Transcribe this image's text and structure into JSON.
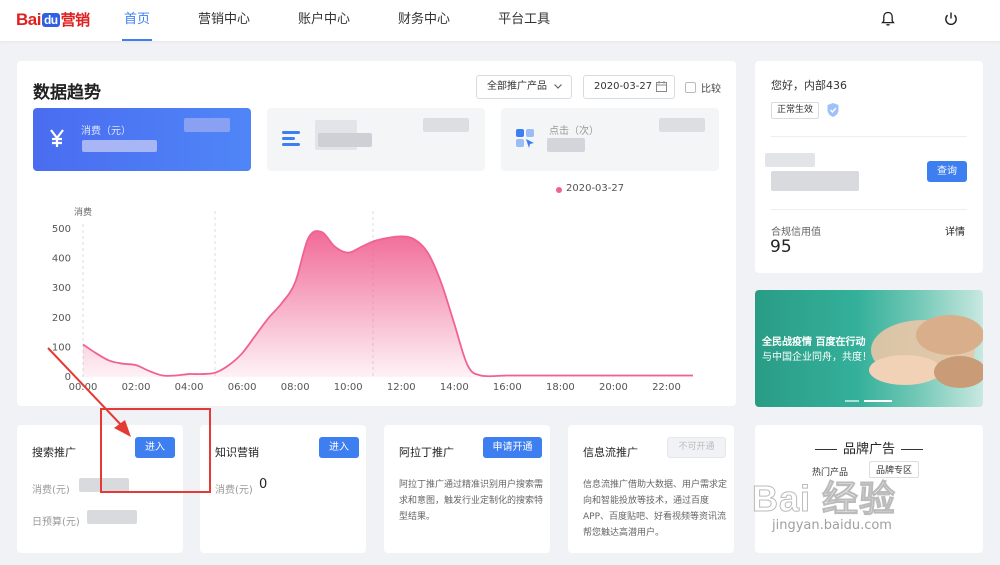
{
  "header": {
    "logo_bai": "Bai",
    "logo_du": "du",
    "logo_suffix": "营销",
    "nav": [
      "首页",
      "营销中心",
      "账户中心",
      "财务中心",
      "平台工具"
    ],
    "icons": [
      "bell-icon",
      "power-icon"
    ]
  },
  "trend": {
    "title": "数据趋势",
    "product_select": "全部推广产品",
    "date": "2020-03-27",
    "compare_label": "比较",
    "stats": [
      {
        "label": "消费（元）",
        "icon": "yuan-icon"
      },
      {
        "label": "",
        "icon": "list-icon"
      },
      {
        "label": "点击（次）",
        "icon": "grid-click-icon"
      }
    ]
  },
  "chart_data": {
    "type": "area",
    "legend": [
      "2020-03-27"
    ],
    "ylabel": "消费",
    "ylim": [
      0,
      500
    ],
    "yticks": [
      "0",
      "100",
      "200",
      "300",
      "400",
      "500"
    ],
    "xticks": [
      "00:00",
      "02:00",
      "04:00",
      "06:00",
      "08:00",
      "10:00",
      "12:00",
      "14:00",
      "16:00",
      "18:00",
      "20:00",
      "22:00"
    ],
    "x": [
      0,
      0.5,
      1,
      1.5,
      2,
      2.5,
      3,
      3.5,
      4,
      4.5,
      5,
      5.5,
      6,
      6.5,
      7,
      7.5,
      8,
      8.5,
      9,
      9.5,
      10,
      10.5,
      11,
      11.5,
      12,
      12.5,
      13,
      13.5,
      14,
      14.5,
      15,
      16,
      17,
      18,
      19,
      20,
      21,
      22,
      23
    ],
    "values": [
      110,
      80,
      55,
      45,
      40,
      20,
      5,
      5,
      10,
      10,
      15,
      40,
      80,
      140,
      200,
      250,
      320,
      470,
      490,
      440,
      420,
      440,
      460,
      470,
      475,
      465,
      420,
      320,
      180,
      40,
      5,
      5,
      5,
      5,
      5,
      5,
      5,
      5,
      5
    ],
    "color": "#f06292",
    "grid": false
  },
  "account": {
    "greeting": "您好，内部436",
    "status_badge": "正常生效",
    "query_button": "查询",
    "credit_label": "合规信用值",
    "credit_value": "95",
    "detail_link": "详情"
  },
  "banner": {
    "line1": "全民战疫情 百度在行动",
    "line2": "与中国企业同舟，共度！"
  },
  "products": [
    {
      "title": "搜索推广",
      "button": "进入",
      "line1": "消费(元)",
      "line2": "日预算(元)"
    },
    {
      "title": "知识营销",
      "button": "进入",
      "line1": "消费(元)",
      "line1_value": "0"
    },
    {
      "title": "阿拉丁推广",
      "button": "申请开通",
      "desc": "阿拉丁推广通过精准识别用户搜索需求和意图，触发行业定制化的搜索特型结果。"
    },
    {
      "title": "信息流推广",
      "button": "不可开通",
      "desc": "信息流推广借助大数据、用户需求定向和智能投放等技术，通过百度APP、百度贴吧、好看视频等资讯流帮您触达高潜用户。"
    }
  ],
  "brand": {
    "title": "品牌广告",
    "hot_label": "热门产品",
    "brand_zone": "品牌专区"
  },
  "watermark": {
    "logo": "Bai 经验",
    "url": "jingyan.baidu.com"
  }
}
